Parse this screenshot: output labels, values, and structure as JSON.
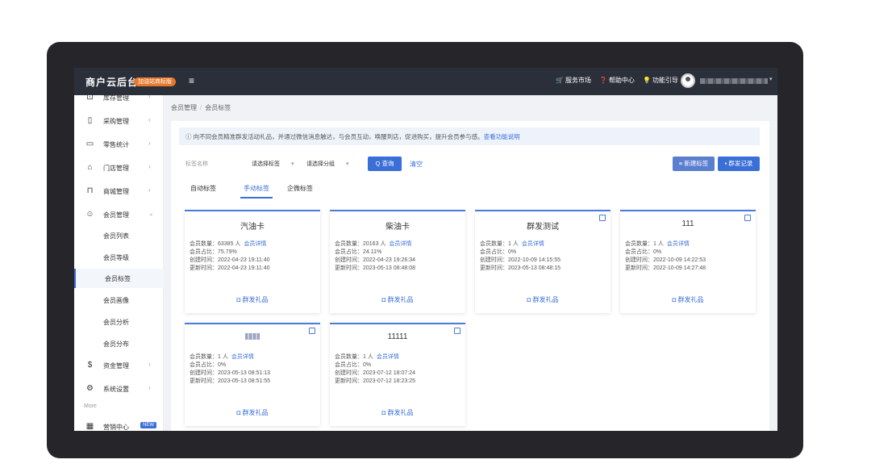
{
  "app": {
    "brand": "商户云后台",
    "trial_badge": "加油站商标版",
    "top_nav": [
      {
        "icon": "cart-icon",
        "label": "服务市场"
      },
      {
        "icon": "help-icon",
        "label": "帮助中心"
      },
      {
        "icon": "bulb-icon",
        "label": "功能引导"
      }
    ],
    "colors": {
      "accent": "#3a6fd8",
      "topbar": "#2b2f3a",
      "brand_badge": "#e8782a"
    }
  },
  "sidebar": {
    "items": [
      {
        "label": "库存管理",
        "icon": "inventory-icon"
      },
      {
        "label": "采购管理",
        "icon": "purchase-icon"
      },
      {
        "label": "零售统计",
        "icon": "stats-icon"
      },
      {
        "label": "门店管理",
        "icon": "store-icon"
      },
      {
        "label": "商城管理",
        "icon": "mall-icon"
      },
      {
        "label": "会员管理",
        "icon": "member-icon"
      }
    ],
    "sub_items": [
      "会员列表",
      "会员等级",
      "会员标签",
      "会员画像",
      "会员分析",
      "会员分布"
    ],
    "bottom_items": [
      {
        "label": "资金管理",
        "icon": "dollar-icon"
      },
      {
        "label": "系统设置",
        "icon": "settings-icon"
      }
    ],
    "more_label": "More",
    "cut_item": {
      "label": "营销中心",
      "badge": "NEW"
    }
  },
  "breadcrumb": [
    "会员管理",
    "会员标签"
  ],
  "notice": {
    "text": "ⓘ 向不同会员精准群发活动礼品，并通过微信消息触达，与会员互动，唤醒到店，促进购买，提升会员参与感。",
    "link": "查看功能说明"
  },
  "filter": {
    "name_label": "标签名称",
    "select_tag": "请选择标签",
    "select_group": "请选择分组",
    "query_button": "Q 查询",
    "clear_button": "清空",
    "new_button": "新建标签",
    "record_button": "群发记录"
  },
  "tabs": [
    "自动标签",
    "手动标签",
    "企微标签"
  ],
  "card_labels": {
    "count": "会员数量：",
    "ratio": "会员占比：",
    "created": "创建时间：",
    "updated": "更新时间：",
    "detail": "会员详情",
    "send": "群发礼品"
  },
  "cards": [
    {
      "title": "汽油卡",
      "count": "63385 人",
      "ratio": "75.79%",
      "created": "2022-04-23 19:11:40",
      "updated": "2022-04-23 19:11:40"
    },
    {
      "title": "柴油卡",
      "count": "20163 人",
      "ratio": "24.11%",
      "created": "2022-04-23 19:26:34",
      "updated": "2023-05-13 08:48:08"
    },
    {
      "title": "群发测试",
      "count": "1 人",
      "ratio": "0%",
      "created": "2022-10-09 14:15:55",
      "updated": "2023-05-13 08:48:15"
    },
    {
      "title": "111",
      "count": "1 人",
      "ratio": "0%",
      "created": "2022-10-09 14:22:53",
      "updated": "2022-10-09 14:27:48"
    },
    {
      "title": "",
      "count": "1 人",
      "ratio": "0%",
      "created": "2023-05-13 08:51:13",
      "updated": "2023-05-13 08:51:55"
    },
    {
      "title": "11111",
      "count": "1 人",
      "ratio": "0%",
      "created": "2023-07-12 18:07:24",
      "updated": "2023-07-12 18:23:25"
    }
  ]
}
